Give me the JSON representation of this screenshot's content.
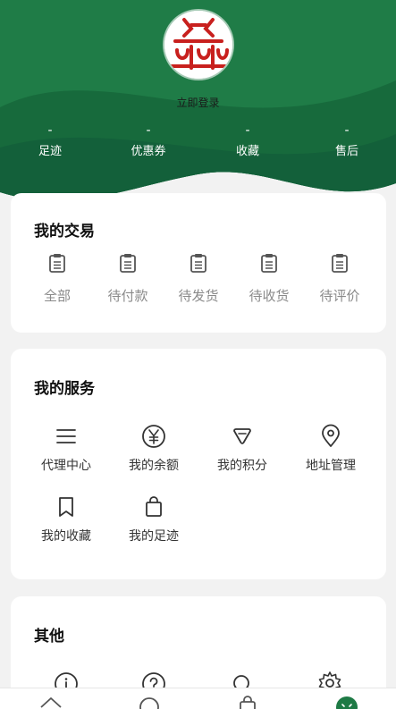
{
  "profile": {
    "login_text": "立即登录"
  },
  "stats": [
    {
      "value": "-",
      "label": "足迹"
    },
    {
      "value": "-",
      "label": "优惠券"
    },
    {
      "value": "-",
      "label": "收藏"
    },
    {
      "value": "-",
      "label": "售后"
    }
  ],
  "trade": {
    "title": "我的交易",
    "items": [
      {
        "label": "全部",
        "icon": "clipboard-icon"
      },
      {
        "label": "待付款",
        "icon": "clipboard-icon"
      },
      {
        "label": "待发货",
        "icon": "clipboard-icon"
      },
      {
        "label": "待收货",
        "icon": "clipboard-icon"
      },
      {
        "label": "待评价",
        "icon": "clipboard-icon"
      }
    ]
  },
  "services": {
    "title": "我的服务",
    "items": [
      {
        "label": "代理中心",
        "icon": "list-icon"
      },
      {
        "label": "我的余额",
        "icon": "yen-icon"
      },
      {
        "label": "我的积分",
        "icon": "points-icon"
      },
      {
        "label": "地址管理",
        "icon": "location-icon"
      },
      {
        "label": "我的收藏",
        "icon": "bookmark-icon"
      },
      {
        "label": "我的足迹",
        "icon": "shopping-bag-icon"
      }
    ]
  },
  "other": {
    "title": "其他"
  },
  "colors": {
    "brand_green": "#1e7a45",
    "dark_green": "#14603a",
    "logo_red": "#c8201e"
  }
}
